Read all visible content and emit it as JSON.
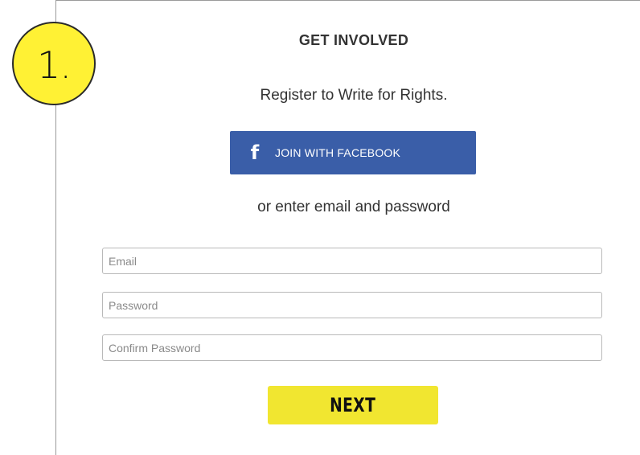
{
  "step_badge": {
    "label": "1."
  },
  "form": {
    "heading": "GET INVOLVED",
    "subtitle": "Register to Write for Rights.",
    "facebook_button": {
      "icon": "facebook-icon",
      "label": "JOIN WITH FACEBOOK",
      "color": "#3a5ea8"
    },
    "divider_text": "or enter email and password",
    "email": {
      "placeholder": "Email",
      "value": ""
    },
    "password": {
      "placeholder": "Password",
      "value": ""
    },
    "confirm_password": {
      "placeholder": "Confirm Password",
      "value": ""
    },
    "next_button": {
      "label": "NEXT",
      "color": "#f1e630"
    }
  },
  "colors": {
    "badge": "#fff134",
    "text": "#333333"
  }
}
